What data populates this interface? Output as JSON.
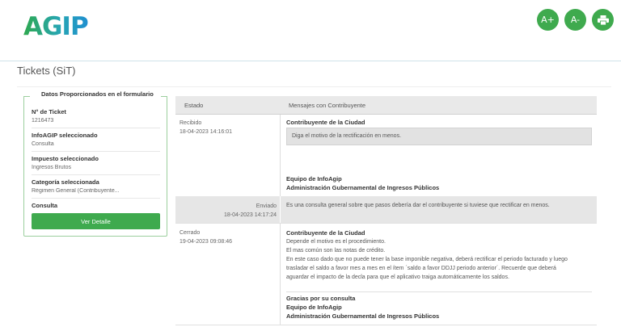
{
  "header": {
    "logo_text": "AGIP",
    "font_increase_label": "A+",
    "font_decrease_label": "A-",
    "print_icon": "print-icon"
  },
  "page_title": "Tickets (SiT)",
  "form": {
    "legend": "Datos Proporcionados en el formulario",
    "fields": [
      {
        "label": "N° de Ticket",
        "value": "1216473"
      },
      {
        "label": "InfoAGIP seleccionado",
        "value": "Consulta"
      },
      {
        "label": "Impuesto seleccionado",
        "value": "Ingresos Brutos"
      },
      {
        "label": "Categoría seleccionada",
        "value": "Régimen General (Contribuyente..."
      }
    ],
    "consulta_label": "Consulta",
    "ver_detalle_label": "Ver Detalle"
  },
  "table": {
    "headers": {
      "estado": "Estado",
      "mensajes": "Mensajes con Contribuyente"
    },
    "rows": [
      {
        "state": "Recibido",
        "timestamp": "18-04-2023 14:16:01",
        "author": "Contribuyente de la Ciudad",
        "message": "Diga el motivo de la rectificación en menos.",
        "signature": [
          "Equipo de InfoAgip",
          "Administración Gubernamental de Ingresos Públicos"
        ]
      },
      {
        "state": "Enviado",
        "timestamp": "18-04-2023 14:17:24",
        "message": "Es una consulta general sobre que pasos debería dar el contribuyente si tuviese que rectificar en menos."
      },
      {
        "state": "Cerrado",
        "timestamp": "19-04-2023 09:08:46",
        "author": "Contribuyente de la Ciudad",
        "lines": [
          "Depende el motivo es el procedimiento.",
          "El mas común son las notas de crédito.",
          "En este caso dado que no puede tener la base imponible negativa, deberá rectificar el periodo facturado y luego",
          "trasladar el saldo a favor mes a mes en el ítem ´saldo a favor DDJJ periodo anterior´. Recuerde que deberá",
          "aguardar el impacto de la decla para que el aplicativo traiga automáticamente los saldos."
        ],
        "signature": [
          "Gracias por su consulta",
          "Equipo de InfoAgip",
          "Administración Gubernamental de Ingresos Públicos"
        ]
      }
    ]
  }
}
